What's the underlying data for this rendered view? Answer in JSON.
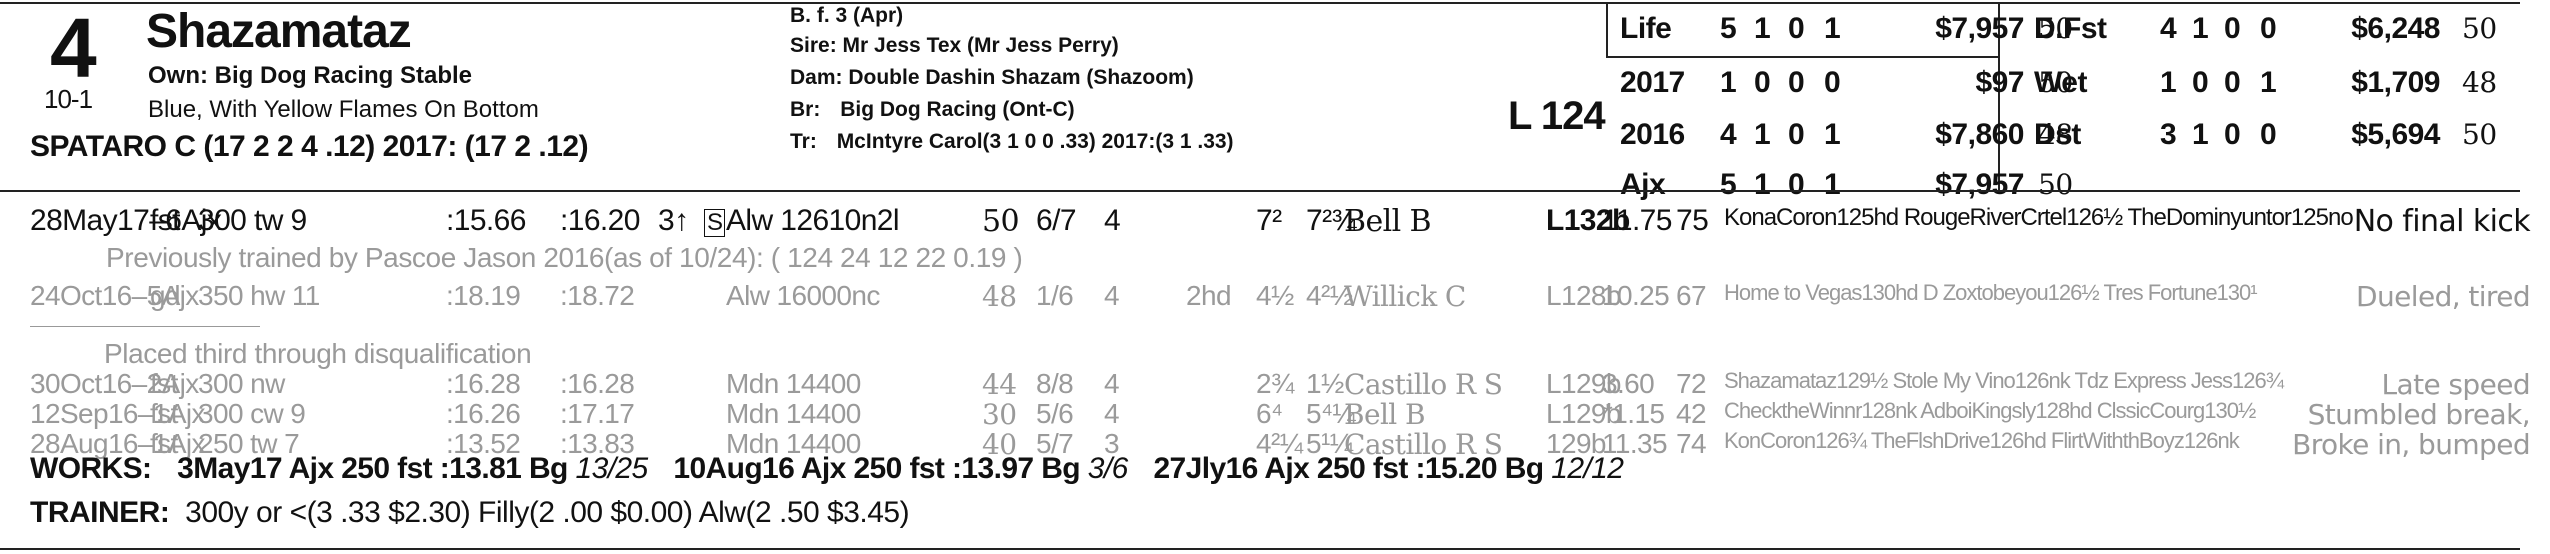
{
  "horse": {
    "post": "4",
    "odds": "10-1",
    "name": "Shazamataz",
    "owner_label": "Own:",
    "owner": "Big Dog Racing Stable",
    "silks": "Blue, With Yellow Flames On Bottom",
    "jockey_line": "SPATARO C (17 2 2 4 .12) 2017: (17 2 .12)",
    "sex_age": "B. f. 3 (Apr)",
    "sire": "Sire: Mr Jess Tex (Mr Jess Perry)",
    "dam": "Dam: Double Dashin Shazam (Shazoom)",
    "breeder_label": "Br:",
    "breeder": "Big Dog Racing (Ont-C)",
    "trainer_label": "Tr:",
    "trainer": "McIntyre Carol(3 1 0 0 .33) 2017:(3 1 .33)",
    "weight": "L 124"
  },
  "stats_left": [
    {
      "label": "Life",
      "st": "5",
      "w": "1",
      "p": "0",
      "s": "1",
      "earn": "$7,957",
      "sr": "50"
    },
    {
      "label": "2017",
      "st": "1",
      "w": "0",
      "p": "0",
      "s": "0",
      "earn": "$97",
      "sr": "50"
    },
    {
      "label": "2016",
      "st": "4",
      "w": "1",
      "p": "0",
      "s": "1",
      "earn": "$7,860",
      "sr": "48"
    },
    {
      "label": "Ajx",
      "st": "5",
      "w": "1",
      "p": "0",
      "s": "1",
      "earn": "$7,957",
      "sr": "50"
    }
  ],
  "stats_right": [
    {
      "label": "D.Fst",
      "st": "4",
      "w": "1",
      "p": "0",
      "s": "0",
      "earn": "$6,248",
      "sr": "50"
    },
    {
      "label": "Wet",
      "st": "1",
      "w": "0",
      "p": "0",
      "s": "1",
      "earn": "$1,709",
      "sr": "48"
    },
    {
      "label": "Dst",
      "st": "3",
      "w": "1",
      "p": "0",
      "s": "0",
      "earn": "$5,694",
      "sr": "50"
    }
  ],
  "races": [
    {
      "date": "28May17–6Ajx",
      "cond": "fst",
      "dist": "300 tw 9",
      "f1": ":15.66",
      "f2": ":16.20",
      "age": "3↑",
      "sbox": "S",
      "rtype": "Alw 12610n2l",
      "spd": "50",
      "pp": "6/7",
      "st": "4",
      "c1": "",
      "fin1": "7²",
      "fin2": "7²¾",
      "jockey": "Bell B",
      "wt": "L132b",
      "odds": "11.75",
      "sr": "75",
      "comp": "KonaCoron125hd RougeRiverCrtel126½ TheDominyuntor125no",
      "comment": "No final kick",
      "gray": false
    },
    {
      "date": "24Oct16–5Ajx",
      "cond": "gd",
      "dist": "350 hw 11",
      "f1": ":18.19",
      "f2": ":18.72",
      "age": "",
      "sbox": "",
      "rtype": "Alw 16000nc",
      "spd": "48",
      "pp": "1/6",
      "st": "4",
      "c1": "2hd",
      "fin1": "4½",
      "fin2": "4²½",
      "jockey": "Willick C",
      "wt": "L128b",
      "odds": "10.25",
      "sr": "67",
      "comp": "Home to Vegas130hd D Zoxtobeyou126½ Tres Fortune130¹",
      "comment": "Dueled, tired",
      "gray": true
    },
    {
      "date": "30Oct16–2Ajx",
      "cond": "fst",
      "dist": "300 nw",
      "f1": ":16.28",
      "f2": ":16.28",
      "age": "",
      "sbox": "",
      "rtype": "Mdn 14400",
      "spd": "44",
      "pp": "8/8",
      "st": "4",
      "c1": "",
      "fin1": "2¾",
      "fin2": "1½",
      "jockey": "Castillo R S",
      "wt": "L129b",
      "odds": "3.60",
      "sr": "72",
      "comp": "Shazamataz129½ Stole My Vino126nk Tdz Express Jess126¾",
      "comment": "Late speed",
      "gray": true
    },
    {
      "date": "12Sep16–1Ajx",
      "cond": "fst",
      "dist": "300 cw 9",
      "f1": ":16.26",
      "f2": ":17.17",
      "age": "",
      "sbox": "",
      "rtype": "Mdn 14400",
      "spd": "30",
      "pp": "5/6",
      "st": "4",
      "c1": "",
      "fin1": "6⁴",
      "fin2": "5⁴¼",
      "jockey": "Bell B",
      "wt": "L129b",
      "odds": "*1.15",
      "sr": "42",
      "comp": "ChecktheWinnr128nk AdboiKingsly128hd ClssicCourg130½",
      "comment": "Stumbled break,",
      "gray": true
    },
    {
      "date": "28Aug16–1Ajx",
      "cond": "fst",
      "dist": "250 tw 7",
      "f1": ":13.52",
      "f2": ":13.83",
      "age": "",
      "sbox": "",
      "rtype": "Mdn 14400",
      "spd": "40",
      "pp": "5/7",
      "st": "3",
      "c1": "",
      "fin1": "4²¼",
      "fin2": "5¹¼",
      "jockey": "Castillo R S",
      "wt": "129b",
      "odds": "11.35",
      "sr": "74",
      "comp": "KonCoron126¾ TheFlshDrive126hd FlirtWiththBoyz126nk",
      "comment": "Broke in, bumped",
      "gray": true
    }
  ],
  "notes": {
    "prev_trained": "Previously trained by Pascoe Jason 2016(as of 10/24): ( 124 24 12 22 0.19 )",
    "placed_third": "Placed third through disqualification"
  },
  "works": {
    "label": "WORKS:",
    "w1": "3May17 Ajx 250 fst :13.81 Bg",
    "w1r": "13/25",
    "w2": "10Aug16 Ajx 250 fst :13.97 Bg",
    "w2r": "3/6",
    "w3": "27Jly16 Ajx 250 fst :15.20 Bg",
    "w3r": "12/12"
  },
  "trainer_stats": {
    "label": "TRAINER:",
    "text": "300y or <(3 .33 $2.30) Filly(2 .00 $0.00) Alw(2 .50 $3.45)"
  }
}
